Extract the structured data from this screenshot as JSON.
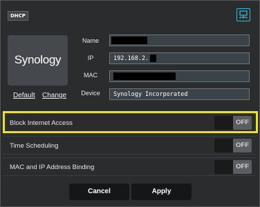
{
  "header": {
    "badge": "DHCP",
    "network_icon": "lan-icon"
  },
  "device_card": {
    "logo_text": "Synology",
    "default_link": "Default",
    "change_link": "Change"
  },
  "fields": {
    "name_label": "Name",
    "name_value": "",
    "ip_label": "IP",
    "ip_value": "192.168.2.",
    "mac_label": "MAC",
    "mac_value": "",
    "device_label": "Device",
    "device_value": "Synology Incorporated"
  },
  "settings": [
    {
      "label": "Block Internet Access",
      "state": "OFF"
    },
    {
      "label": "Time Scheduling",
      "state": "OFF"
    },
    {
      "label": "MAC and IP Address Binding",
      "state": "OFF"
    }
  ],
  "buttons": {
    "cancel": "Cancel",
    "apply": "Apply"
  },
  "colors": {
    "highlight": "#e8e520",
    "accent": "#3ab9e0"
  }
}
